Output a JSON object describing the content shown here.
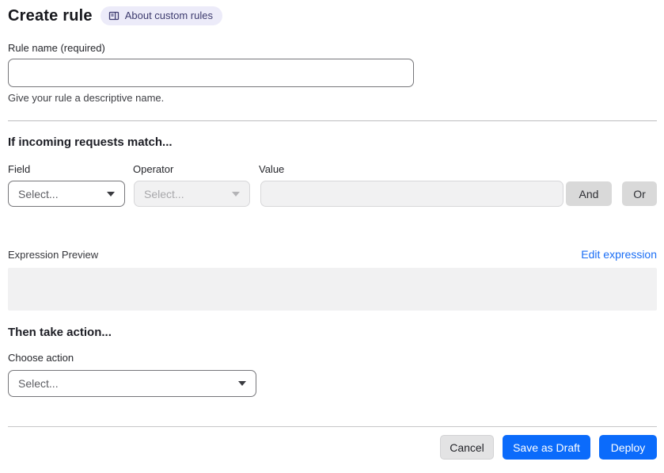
{
  "header": {
    "title": "Create rule",
    "about_link": "About custom rules"
  },
  "rule_name": {
    "label": "Rule name (required)",
    "value": "",
    "help": "Give your rule a descriptive name."
  },
  "match_section": {
    "heading": "If incoming requests match...",
    "field_label": "Field",
    "operator_label": "Operator",
    "value_label": "Value",
    "field_placeholder": "Select...",
    "operator_placeholder": "Select...",
    "value_value": "",
    "and_label": "And",
    "or_label": "Or"
  },
  "expression": {
    "label": "Expression Preview",
    "edit_link": "Edit expression",
    "content": ""
  },
  "action_section": {
    "heading": "Then take action...",
    "choose_label": "Choose action",
    "placeholder": "Select..."
  },
  "footer": {
    "cancel": "Cancel",
    "save_draft": "Save as Draft",
    "deploy": "Deploy"
  },
  "colors": {
    "primary_blue": "#0b6bfb",
    "link_blue": "#1a6ef5",
    "badge_bg": "#ecebf9",
    "badge_text": "#3c3a6e",
    "disabled_bg": "#f1f1f2",
    "gray_button": "#d9d9d9"
  }
}
